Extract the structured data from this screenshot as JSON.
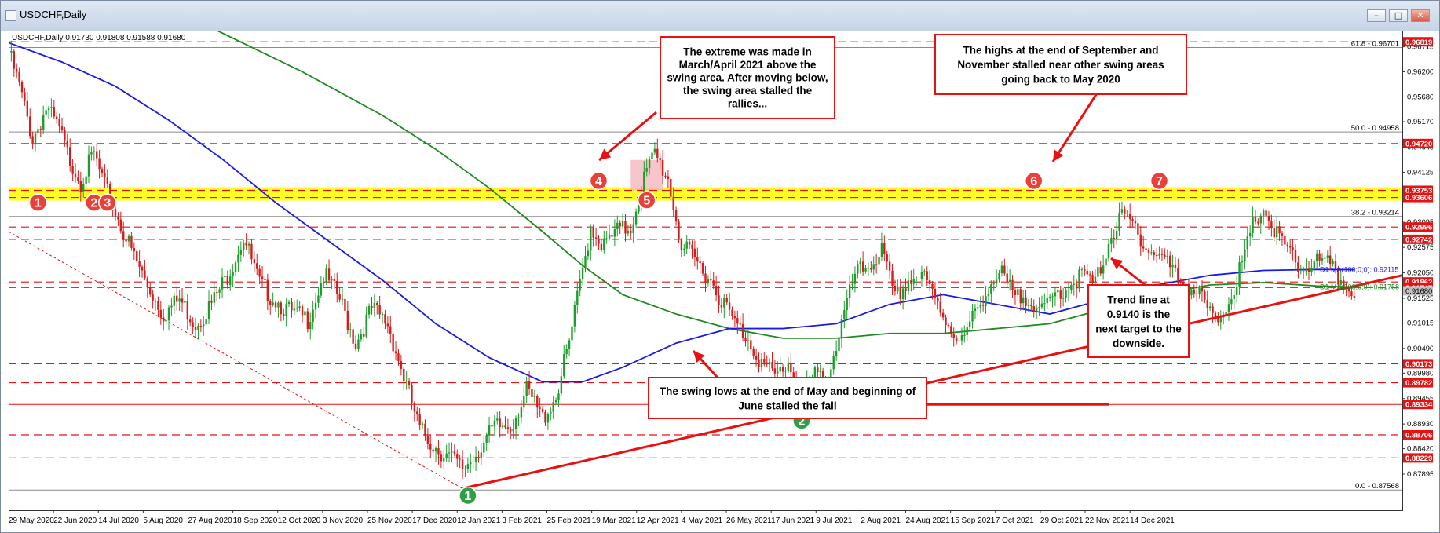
{
  "window": {
    "title": "USDCHF,Daily",
    "minimize_glyph": "–",
    "maximize_glyph": "□",
    "close_glyph": "✕"
  },
  "chart_data": {
    "type": "candlestick",
    "symbol_info": "USDCHF,Daily  0.91730 0.91808 0.91588 0.91680",
    "ylim": [
      0.8715,
      0.9705
    ],
    "y_tick_labels": [
      0.96715,
      0.962,
      0.9568,
      0.9517,
      0.94645,
      0.94125,
      0.93605,
      0.93095,
      0.92575,
      0.9205,
      0.91525,
      0.91015,
      0.9049,
      0.8998,
      0.89455,
      0.8893,
      0.8842,
      0.87895
    ],
    "x_tick_labels": [
      "29 May 2020",
      "22 Jun 2020",
      "14 Jul 2020",
      "5 Aug 2020",
      "27 Aug 2020",
      "18 Sep 2020",
      "12 Oct 2020",
      "3 Nov 2020",
      "25 Nov 2020",
      "17 Dec 2020",
      "12 Jan 2021",
      "3 Feb 2021",
      "25 Feb 2021",
      "19 Mar 2021",
      "12 Apr 2021",
      "4 May 2021",
      "26 May 2021",
      "17 Jun 2021",
      "9 Jul 2021",
      "2 Aug 2021",
      "24 Aug 2021",
      "15 Sep 2021",
      "7 Oct 2021",
      "29 Oct 2021",
      "22 Nov 2021",
      "14 Dec 2021"
    ],
    "close_path": [
      [
        0,
        0.966
      ],
      [
        4,
        0.959
      ],
      [
        9,
        0.948
      ],
      [
        14,
        0.9545
      ],
      [
        19,
        0.95
      ],
      [
        22,
        0.945
      ],
      [
        27,
        0.9395
      ],
      [
        32,
        0.945
      ],
      [
        36,
        0.938
      ],
      [
        40,
        0.933
      ],
      [
        46,
        0.925
      ],
      [
        52,
        0.918
      ],
      [
        58,
        0.912
      ],
      [
        64,
        0.915
      ],
      [
        70,
        0.91
      ],
      [
        76,
        0.914
      ],
      [
        82,
        0.92
      ],
      [
        88,
        0.928
      ],
      [
        94,
        0.918
      ],
      [
        100,
        0.915
      ],
      [
        106,
        0.912
      ],
      [
        112,
        0.911
      ],
      [
        118,
        0.92
      ],
      [
        124,
        0.915
      ],
      [
        130,
        0.906
      ],
      [
        136,
        0.913
      ],
      [
        142,
        0.91
      ],
      [
        148,
        0.899
      ],
      [
        154,
        0.888
      ],
      [
        160,
        0.8845
      ],
      [
        166,
        0.882
      ],
      [
        170,
        0.88
      ],
      [
        176,
        0.884
      ],
      [
        182,
        0.8885
      ],
      [
        188,
        0.889
      ],
      [
        194,
        0.896
      ],
      [
        200,
        0.8905
      ],
      [
        205,
        0.895
      ],
      [
        210,
        0.906
      ],
      [
        214,
        0.918
      ],
      [
        218,
        0.93
      ],
      [
        223,
        0.926
      ],
      [
        228,
        0.929
      ],
      [
        233,
        0.93
      ],
      [
        238,
        0.94
      ],
      [
        242,
        0.945
      ],
      [
        247,
        0.94
      ],
      [
        252,
        0.926
      ],
      [
        257,
        0.923
      ],
      [
        262,
        0.92
      ],
      [
        267,
        0.915
      ],
      [
        272,
        0.91
      ],
      [
        277,
        0.907
      ],
      [
        282,
        0.902
      ],
      [
        287,
        0.899
      ],
      [
        292,
        0.902
      ],
      [
        297,
        0.895
      ],
      [
        302,
        0.899
      ],
      [
        307,
        0.899
      ],
      [
        312,
        0.91
      ],
      [
        317,
        0.92
      ],
      [
        322,
        0.922
      ],
      [
        327,
        0.925
      ],
      [
        332,
        0.915
      ],
      [
        337,
        0.919
      ],
      [
        342,
        0.92
      ],
      [
        347,
        0.915
      ],
      [
        352,
        0.91
      ],
      [
        357,
        0.906
      ],
      [
        362,
        0.912
      ],
      [
        367,
        0.918
      ],
      [
        372,
        0.92
      ],
      [
        377,
        0.915
      ],
      [
        382,
        0.916
      ],
      [
        387,
        0.912
      ],
      [
        392,
        0.916
      ],
      [
        397,
        0.918
      ],
      [
        402,
        0.92
      ],
      [
        407,
        0.918
      ],
      [
        412,
        0.927
      ],
      [
        417,
        0.932
      ],
      [
        422,
        0.93
      ],
      [
        427,
        0.925
      ],
      [
        432,
        0.924
      ],
      [
        437,
        0.92
      ],
      [
        442,
        0.918
      ],
      [
        447,
        0.915
      ],
      [
        452,
        0.91
      ],
      [
        457,
        0.915
      ],
      [
        462,
        0.922
      ],
      [
        466,
        0.93
      ],
      [
        470,
        0.934
      ],
      [
        474,
        0.929
      ],
      [
        479,
        0.925
      ],
      [
        484,
        0.921
      ],
      [
        489,
        0.923
      ],
      [
        494,
        0.922
      ],
      [
        499,
        0.919
      ],
      [
        504,
        0.917
      ]
    ],
    "hlines": [
      {
        "label": "61.8 - 0.96701",
        "value": 0.96701,
        "color": "#8a8a8a",
        "dash": false,
        "box": false
      },
      {
        "label": "0.96819",
        "value": 0.96819,
        "color": "#e81010",
        "dash": true,
        "box": true
      },
      {
        "label": "50.0 - 0.94958",
        "value": 0.94958,
        "color": "#8a8a8a",
        "dash": false,
        "box": false
      },
      {
        "label": "0.94720",
        "value": 0.9472,
        "color": "#e81010",
        "dash": true,
        "box": true
      },
      {
        "label": "0.93753",
        "value": 0.93753,
        "color": "#e81010",
        "dash": true,
        "box": true
      },
      {
        "label": "0.93606",
        "value": 0.93606,
        "color": "#e81010",
        "dash": true,
        "box": true
      },
      {
        "label": "38.2 - 0.93214",
        "value": 0.93214,
        "color": "#8a8a8a",
        "dash": false,
        "box": false
      },
      {
        "label": "0.92996",
        "value": 0.92996,
        "color": "#e81010",
        "dash": true,
        "box": true
      },
      {
        "label": "0.92742",
        "value": 0.92742,
        "color": "#e81010",
        "dash": true,
        "box": true
      },
      {
        "label": "0.91862",
        "value": 0.91862,
        "color": "#e81010",
        "dash": true,
        "box": true
      },
      {
        "label": "0.91747",
        "value": 0.91747,
        "color": "#e81010",
        "dash": true,
        "box": true
      },
      {
        "label": "0.90173",
        "value": 0.90173,
        "color": "#e81010",
        "dash": true,
        "box": true
      },
      {
        "label": "0.89782",
        "value": 0.89782,
        "color": "#e81010",
        "dash": true,
        "box": true
      },
      {
        "label": "0.89334",
        "value": 0.89334,
        "color": "#e81010",
        "dash": false,
        "box": true
      },
      {
        "label": "0.88706",
        "value": 0.88706,
        "color": "#e81010",
        "dash": true,
        "box": true
      },
      {
        "label": "0.88229",
        "value": 0.88229,
        "color": "#e81010",
        "dash": true,
        "box": true
      },
      {
        "label": "0.0 - 0.87568",
        "value": 0.87568,
        "color": "#8a8a8a",
        "dash": false,
        "box": false
      }
    ],
    "current_price_label": "0.91680",
    "current_price": 0.9168,
    "ma_labels": {
      "ma100": "D1 MA(100;0;0): 0.92115",
      "ma200": "D1 MA(200;0;0): 0.91758"
    },
    "ma100_points": [
      [
        0,
        0.968
      ],
      [
        20,
        0.964
      ],
      [
        40,
        0.959
      ],
      [
        60,
        0.952
      ],
      [
        80,
        0.944
      ],
      [
        100,
        0.935
      ],
      [
        120,
        0.927
      ],
      [
        140,
        0.919
      ],
      [
        160,
        0.91
      ],
      [
        180,
        0.903
      ],
      [
        200,
        0.898
      ],
      [
        215,
        0.898
      ],
      [
        230,
        0.901
      ],
      [
        250,
        0.906
      ],
      [
        270,
        0.909
      ],
      [
        290,
        0.909
      ],
      [
        310,
        0.91
      ],
      [
        330,
        0.914
      ],
      [
        350,
        0.916
      ],
      [
        370,
        0.914
      ],
      [
        390,
        0.912
      ],
      [
        410,
        0.915
      ],
      [
        430,
        0.918
      ],
      [
        450,
        0.92
      ],
      [
        470,
        0.921
      ],
      [
        490,
        0.9212
      ],
      [
        504,
        0.92115
      ]
    ],
    "ma200_points": [
      [
        50,
        0.978
      ],
      [
        80,
        0.97
      ],
      [
        110,
        0.962
      ],
      [
        140,
        0.953
      ],
      [
        160,
        0.946
      ],
      [
        180,
        0.938
      ],
      [
        200,
        0.929
      ],
      [
        215,
        0.922
      ],
      [
        230,
        0.916
      ],
      [
        250,
        0.912
      ],
      [
        270,
        0.909
      ],
      [
        290,
        0.907
      ],
      [
        310,
        0.907
      ],
      [
        330,
        0.908
      ],
      [
        350,
        0.908
      ],
      [
        370,
        0.909
      ],
      [
        390,
        0.91
      ],
      [
        410,
        0.913
      ],
      [
        430,
        0.916
      ],
      [
        450,
        0.918
      ],
      [
        470,
        0.9185
      ],
      [
        490,
        0.9178
      ],
      [
        504,
        0.91758
      ]
    ],
    "trendline": [
      [
        170,
        0.876
      ],
      [
        522,
        0.92
      ]
    ],
    "old_trendline": [
      [
        0,
        0.929
      ],
      [
        170,
        0.876
      ]
    ],
    "swing_low_line": [
      [
        269,
        0.89334
      ],
      [
        412,
        0.89334
      ]
    ],
    "highlight_band": [
      0.93606,
      0.93753
    ],
    "shaded_box": {
      "x": [
        233,
        245
      ],
      "y": [
        0.93753,
        0.9438
      ]
    },
    "markers": [
      {
        "label": "1",
        "x": 11,
        "y": 0.935,
        "color": "#e8403a"
      },
      {
        "label": "2",
        "x": 32,
        "y": 0.935,
        "color": "#e8403a"
      },
      {
        "label": "3",
        "x": 37,
        "y": 0.935,
        "color": "#e8403a"
      },
      {
        "label": "4",
        "x": 221,
        "y": 0.9395,
        "color": "#e8403a"
      },
      {
        "label": "5",
        "x": 239,
        "y": 0.9355,
        "color": "#e8403a"
      },
      {
        "label": "6",
        "x": 384,
        "y": 0.9395,
        "color": "#e8403a"
      },
      {
        "label": "7",
        "x": 431,
        "y": 0.9395,
        "color": "#e8403a"
      },
      {
        "label": "1",
        "x": 172,
        "y": 0.8745,
        "color": "#2ea043"
      },
      {
        "label": "2",
        "x": 297,
        "y": 0.89,
        "color": "#2ea043"
      },
      {
        "label": "3",
        "x": 410,
        "y": 0.905,
        "color": "#2ea043"
      }
    ],
    "annotations": [
      {
        "lines": [
          "The extreme was made in",
          "March/April 2021 above the",
          "swing area. After moving below,",
          "the swing area stalled the",
          "rallies..."
        ]
      },
      {
        "lines": [
          "The highs at the end of September and",
          "November stalled near other swing areas",
          "going back to May 2020"
        ]
      },
      {
        "lines": [
          "Trend line at",
          "0.9140 is the",
          "next target to the",
          "downside."
        ]
      },
      {
        "lines": [
          "The swing lows at the end of May and beginning of",
          "June stalled the fall"
        ]
      }
    ]
  }
}
